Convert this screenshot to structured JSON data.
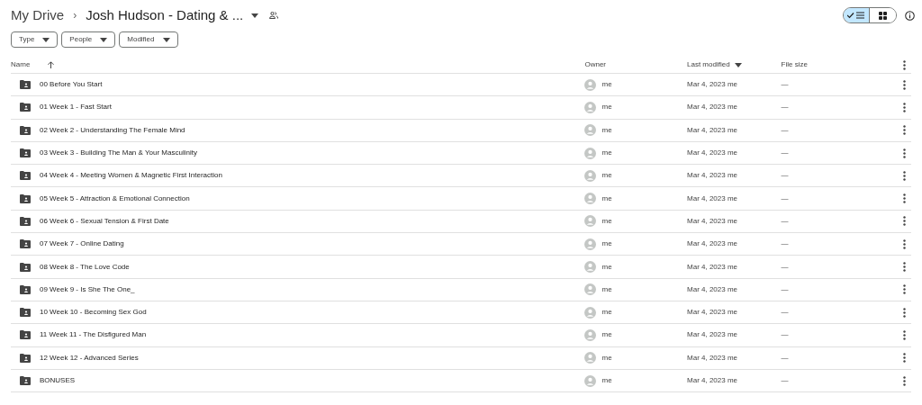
{
  "breadcrumb": {
    "root": "My Drive",
    "separator": "›",
    "current": "Josh Hudson - Dating & ..."
  },
  "view_toggle": [
    {
      "kind": "list",
      "selected": true
    },
    {
      "kind": "grid",
      "selected": false
    }
  ],
  "filters": [
    "Type",
    "People",
    "Modified"
  ],
  "columns": {
    "name": "Name",
    "owner": "Owner",
    "modified": "Last modified",
    "size": "File size"
  },
  "rows": [
    {
      "name": "00 Before You Start",
      "owner": "me",
      "modified": "Mar 4, 2023 me",
      "size": "—"
    },
    {
      "name": "01 Week 1 - Fast Start",
      "owner": "me",
      "modified": "Mar 4, 2023 me",
      "size": "—"
    },
    {
      "name": "02 Week 2 - Understanding The Female Mind",
      "owner": "me",
      "modified": "Mar 4, 2023 me",
      "size": "—"
    },
    {
      "name": "03 Week 3 - Building The Man & Your Masculinity",
      "owner": "me",
      "modified": "Mar 4, 2023 me",
      "size": "—"
    },
    {
      "name": "04 Week 4 - Meeting Women & Magnetic First Interaction",
      "owner": "me",
      "modified": "Mar 4, 2023 me",
      "size": "—"
    },
    {
      "name": "05 Week 5 - Attraction & Emotional Connection",
      "owner": "me",
      "modified": "Mar 4, 2023 me",
      "size": "—"
    },
    {
      "name": "06 Week 6 - Sexual Tension & First Date",
      "owner": "me",
      "modified": "Mar 4, 2023 me",
      "size": "—"
    },
    {
      "name": "07 Week 7 - Online Dating",
      "owner": "me",
      "modified": "Mar 4, 2023 me",
      "size": "—"
    },
    {
      "name": "08 Week 8 - The Love Code",
      "owner": "me",
      "modified": "Mar 4, 2023 me",
      "size": "—"
    },
    {
      "name": "09 Week 9 - Is She The One_",
      "owner": "me",
      "modified": "Mar 4, 2023 me",
      "size": "—"
    },
    {
      "name": "10 Week 10 - Becoming Sex God",
      "owner": "me",
      "modified": "Mar 4, 2023 me",
      "size": "—"
    },
    {
      "name": "11 Week 11 - The Disfigured Man",
      "owner": "me",
      "modified": "Mar 4, 2023 me",
      "size": "—"
    },
    {
      "name": "12 Week 12 - Advanced Series",
      "owner": "me",
      "modified": "Mar 4, 2023 me",
      "size": "—"
    },
    {
      "name": "BONUSES",
      "owner": "me",
      "modified": "Mar 4, 2023 me",
      "size": "—"
    }
  ]
}
